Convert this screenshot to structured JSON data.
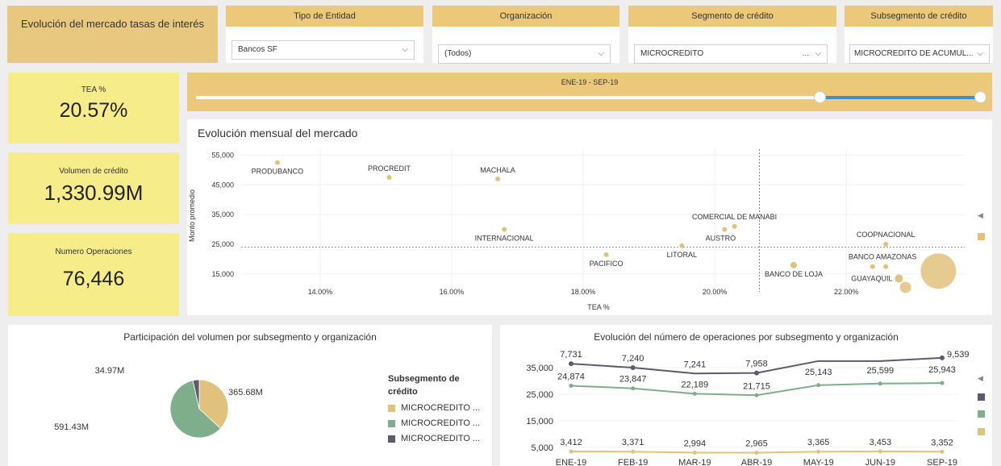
{
  "header": {
    "title": "Evolución del mercado tasas de interés"
  },
  "filters": [
    {
      "label": "Tipo de Entidad",
      "value": "Bancos SF"
    },
    {
      "label": "Organización",
      "value": "(Todos)"
    },
    {
      "label": "Segmento de crédito",
      "value": "MICROCREDITO"
    },
    {
      "label": "Subsegmento de crédito",
      "value": "MICROCREDITO DE ACUMUL..."
    }
  ],
  "kpis": [
    {
      "label": "TEA %",
      "value": "20.57%"
    },
    {
      "label": "Volumen de crédito",
      "value": "1,330.99M"
    },
    {
      "label": "Numero Operaciones",
      "value": "76,446"
    }
  ],
  "slider": {
    "label": "ENE-19 - SEP-19",
    "range_fraction": [
      0.795,
      1.0
    ]
  },
  "colors": {
    "gold": "#e0c27c",
    "green": "#7fae8c",
    "dark": "#5e5a6e",
    "accent_blue": "#3a8fd9",
    "kpi_yellow": "#f6ec8a"
  },
  "icons": {
    "dropdown": "chevron-down-icon",
    "legend_toggle": "caret-left-icon"
  },
  "scatter": {
    "title": "Evolución mensual del mercado",
    "xlabel": "TEA %",
    "ylabel": "Monto promedio",
    "x_ticks": [
      "14.00%",
      "16.00%",
      "18.00%",
      "20.00%",
      "22.00%"
    ],
    "y_ticks": [
      "55,000",
      "45,000",
      "35,000",
      "25,000",
      "15,000"
    ],
    "ref_line_y": 24000,
    "ref_line_x": 20.68
  },
  "pie": {
    "title": "Participación del volumen por subsegmento y organización",
    "labels": [
      "34.97M",
      "365.68M",
      "591.43M"
    ],
    "legend_title": "Subsegmento de crédito",
    "legend_items": [
      "MICROCREDITO ...",
      "MICROCREDITO ...",
      "MICROCREDITO ..."
    ]
  },
  "line": {
    "title": "Evolución del número de operaciones por subsegmento y organización",
    "y_ticks": [
      "35,000",
      "25,000",
      "15,000",
      "5,000"
    ]
  },
  "chart_data": [
    {
      "type": "scatter",
      "title": "Evolución mensual del mercado",
      "xlabel": "TEA %",
      "ylabel": "Monto promedio",
      "xlim": [
        12.8,
        23.8
      ],
      "ylim": [
        9000,
        57000
      ],
      "points": [
        {
          "label": "PRODUBANCO",
          "x": 13.35,
          "y": 52500,
          "size": 3
        },
        {
          "label": "PROCREDIT",
          "x": 15.05,
          "y": 47500,
          "size": 3
        },
        {
          "label": "MACHALA",
          "x": 16.7,
          "y": 47000,
          "size": 3
        },
        {
          "label": "INTERNACIONAL",
          "x": 16.8,
          "y": 30000,
          "size": 3
        },
        {
          "label": "PACIFICO",
          "x": 18.35,
          "y": 21500,
          "size": 3
        },
        {
          "label": "LITORAL",
          "x": 19.5,
          "y": 24500,
          "size": 3
        },
        {
          "label": "COMERCIAL DE MANABI",
          "x": 20.3,
          "y": 31000,
          "size": 3
        },
        {
          "label": "AUSTRO",
          "x": 20.15,
          "y": 30000,
          "size": 3
        },
        {
          "label": "BANCO DE LOJA",
          "x": 21.2,
          "y": 18000,
          "size": 4
        },
        {
          "label": "COOPNACIONAL",
          "x": 22.6,
          "y": 25000,
          "size": 3
        },
        {
          "label": "BANCO AMAZONAS",
          "x": 22.6,
          "y": 17500,
          "size": 3
        },
        {
          "label": "GUAYAQUIL",
          "x": 22.8,
          "y": 13500,
          "size": 5
        },
        {
          "label": "",
          "x": 22.4,
          "y": 17500,
          "size": 3
        },
        {
          "label": "",
          "x": 22.9,
          "y": 10500,
          "size": 7
        },
        {
          "label": "",
          "x": 23.4,
          "y": 16000,
          "size": 22
        }
      ]
    },
    {
      "type": "pie",
      "title": "Participación del volumen por subsegmento y organización",
      "slices": [
        {
          "name": "MICROCREDITO ...",
          "value": 365.68,
          "label": "365.68M",
          "color": "#e0c27c"
        },
        {
          "name": "MICROCREDITO ...",
          "value": 591.43,
          "label": "591.43M",
          "color": "#7fae8c"
        },
        {
          "name": "MICROCREDITO ...",
          "value": 34.97,
          "label": "34.97M",
          "color": "#5e5a6e"
        }
      ]
    },
    {
      "type": "line",
      "title": "Evolución del número de operaciones por subsegmento y organización",
      "categories": [
        "ENE-19",
        "FEB-19",
        "MAR-19",
        "ABR-19",
        "MAY-19",
        "JUN-19",
        "SEP-19"
      ],
      "ylim": [
        1000,
        42000
      ],
      "series": [
        {
          "color": "#5e5a6e",
          "values": [
            36500,
            35000,
            32800,
            33000,
            37500,
            37500,
            38700
          ],
          "labels": [
            "7,731",
            "7,240",
            "7,241",
            "7,958",
            "",
            "",
            "9,539"
          ]
        },
        {
          "color": "#7fae8c",
          "values": [
            28200,
            27200,
            25200,
            24600,
            28400,
            29000,
            29200
          ],
          "labels": [
            "24,874",
            "23,847",
            "22,189",
            "21,715",
            "25,143",
            "25,599",
            "25,943"
          ]
        },
        {
          "color": "#e0c27c",
          "values": [
            3412,
            3371,
            2994,
            2965,
            3365,
            3453,
            3352
          ],
          "labels": [
            "3,412",
            "3,371",
            "2,994",
            "2,965",
            "3,365",
            "3,453",
            "3,352"
          ]
        }
      ]
    }
  ]
}
